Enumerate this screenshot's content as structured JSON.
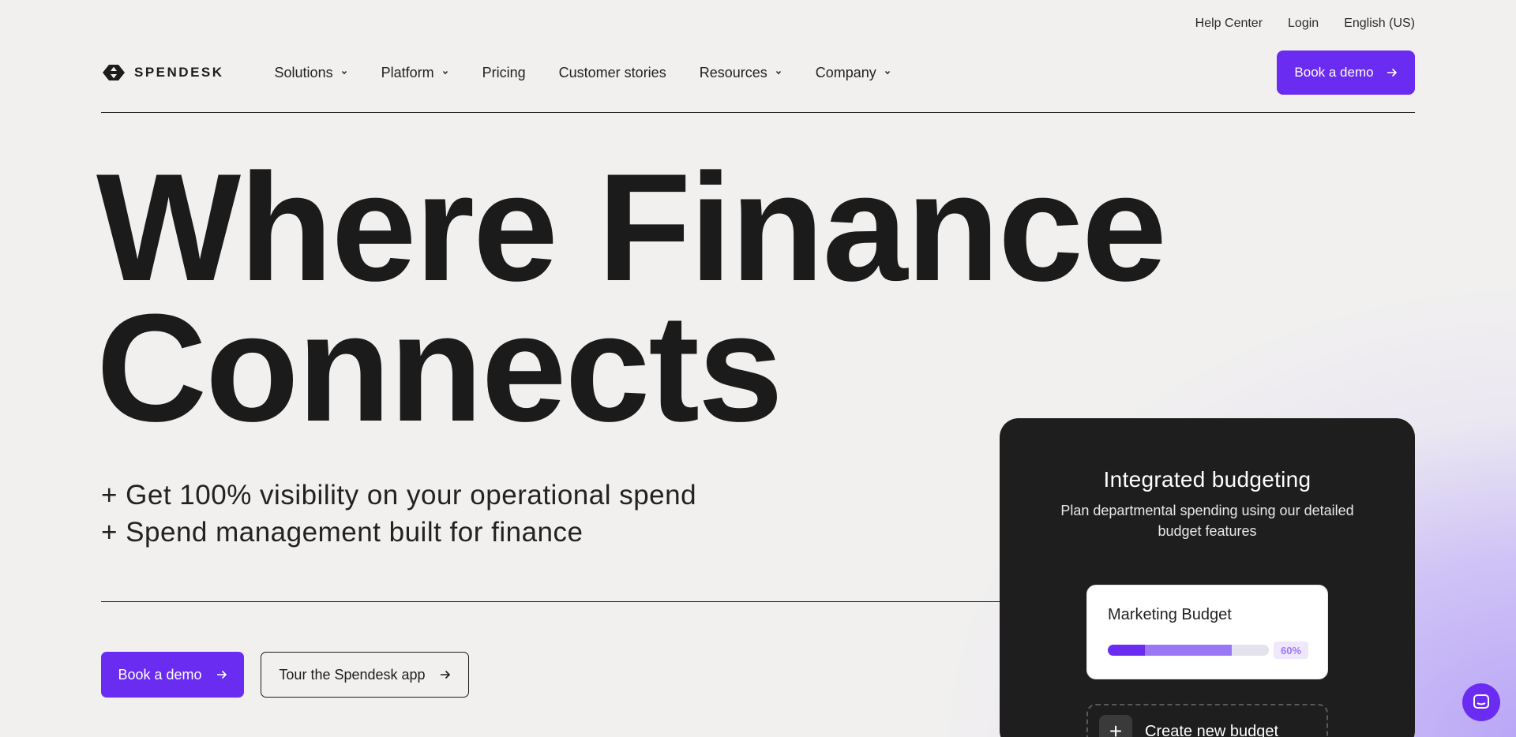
{
  "utility_nav": {
    "help": "Help Center",
    "login": "Login",
    "language": "English (US)"
  },
  "brand": {
    "name": "SPENDESK"
  },
  "nav": {
    "items": [
      {
        "label": "Solutions",
        "has_menu": true
      },
      {
        "label": "Platform",
        "has_menu": true
      },
      {
        "label": "Pricing",
        "has_menu": false
      },
      {
        "label": "Customer stories",
        "has_menu": false
      },
      {
        "label": "Resources",
        "has_menu": true
      },
      {
        "label": "Company",
        "has_menu": true
      }
    ],
    "cta": "Book a demo"
  },
  "hero": {
    "headline_line1": "Where Finance",
    "headline_line2": "Connects",
    "bullet1": "+ Get 100% visibility on your operational spend",
    "bullet2": "+ Spend management built for finance",
    "primary_cta": "Book a demo",
    "secondary_cta": "Tour the Spendesk app"
  },
  "feature_card": {
    "title": "Integrated budgeting",
    "subtitle": "Plan departmental spending using our detailed budget features",
    "budget": {
      "label": "Marketing Budget",
      "spent_fraction": 0.23,
      "committed_fraction": 0.77,
      "percent_label": "60%"
    },
    "create_label": "Create new budget"
  },
  "colors": {
    "accent": "#6b2cf2",
    "accent_light": "#9a78f5",
    "card_bg": "#1e1e1e",
    "page_bg": "#f1f0ef"
  },
  "icons": {
    "arrow": "arrow-right-icon",
    "chevron": "chevron-down-icon",
    "chat": "chat-icon",
    "plus": "plus-icon"
  }
}
